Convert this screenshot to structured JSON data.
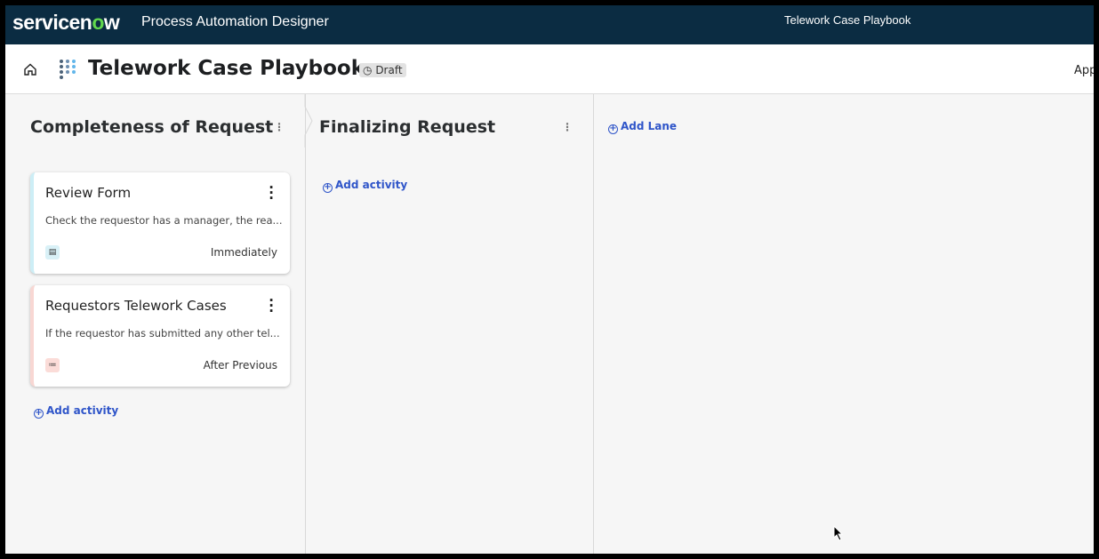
{
  "header": {
    "brand_prefix": "servicen",
    "brand_o": "o",
    "brand_suffix": "w",
    "product": "Process Automation Designer",
    "center_title": "Telework Case Playbook"
  },
  "subheader": {
    "title": "Telework Case Playbook",
    "status": "Draft",
    "right_cut": "App"
  },
  "lanes": [
    {
      "title": "Completeness of Request",
      "add_activity": "Add activity",
      "cards": [
        {
          "title": "Review Form",
          "description": "Check the requestor has a manager, the rea...",
          "trigger": "Immediately",
          "icon": "form-icon",
          "accent": "#cdeef6"
        },
        {
          "title": "Requestors Telework Cases",
          "description": "If the requestor has submitted any other tel...",
          "trigger": "After Previous",
          "icon": "list-icon",
          "accent": "#f8d7d3"
        }
      ]
    },
    {
      "title": "Finalizing Request",
      "add_activity": "Add activity",
      "cards": []
    }
  ],
  "add_lane": "Add Lane",
  "colors": {
    "topbar": "#0b2c42",
    "link": "#2f55c9",
    "brand_green": "#62d84e"
  }
}
